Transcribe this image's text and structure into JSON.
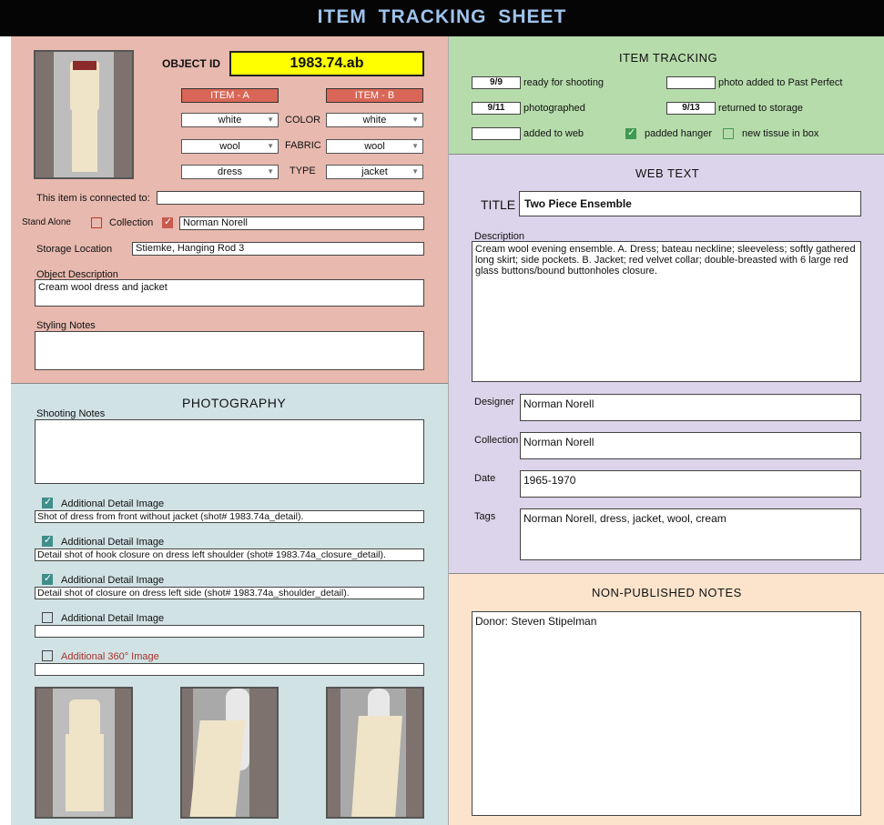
{
  "header": {
    "title": "ITEM TRACKING SHEET"
  },
  "object": {
    "id_label": "OBJECT ID",
    "id_value": "1983.74.ab",
    "item_a": "ITEM - A",
    "item_b": "ITEM - B",
    "color_label": "COLOR",
    "fabric_label": "FABRIC",
    "type_label": "TYPE",
    "a_color": "white",
    "b_color": "white",
    "a_fabric": "wool",
    "b_fabric": "wool",
    "a_type": "dress",
    "b_type": "jacket",
    "connected_label": "This item is connected to:",
    "connected_value": "",
    "standalone_label": "Stand Alone",
    "collection_label": "Collection",
    "collection_value": "Norman Norell",
    "storage_label": "Storage Location",
    "storage_value": "Stiemke, Hanging Rod 3",
    "desc_label": "Object Description",
    "desc_value": "Cream wool dress and jacket",
    "styling_label": "Styling Notes",
    "styling_value": ""
  },
  "photography": {
    "title": "PHOTOGRAPHY",
    "shooting_label": "Shooting Notes",
    "shooting_value": "",
    "details": [
      {
        "label": "Additional Detail Image",
        "checked": true,
        "value": "Shot of dress from front without jacket (shot# 1983.74a_detail)."
      },
      {
        "label": "Additional Detail Image",
        "checked": true,
        "value": "Detail shot of hook closure on dress left shoulder (shot# 1983.74a_closure_detail)."
      },
      {
        "label": "Additional Detail Image",
        "checked": true,
        "value": "Detail shot of closure on dress left side (shot# 1983.74a_shoulder_detail)."
      },
      {
        "label": "Additional Detail Image",
        "checked": false,
        "value": ""
      }
    ],
    "image360_label": "Additional 360° Image",
    "image360_value": ""
  },
  "tracking": {
    "title": "ITEM  TRACKING",
    "ready_date": "9/9",
    "ready_label": "ready for shooting",
    "pp_date": "",
    "pp_label": "photo added to Past Perfect",
    "photographed_date": "9/11",
    "photographed_label": "photographed",
    "returned_date": "9/13",
    "returned_label": "returned to storage",
    "web_date": "",
    "web_label": "added to web",
    "padded_label": "padded hanger",
    "tissue_label": "new tissue in box"
  },
  "web": {
    "title": "WEB TEXT",
    "title_label": "TITLE",
    "title_value": "Two Piece Ensemble",
    "desc_label": "Description",
    "desc_value": "Cream wool evening ensemble. A. Dress; bateau neckline; sleeveless; softly gathered long skirt; side pockets. B. Jacket; red velvet collar; double-breasted with 6 large red glass buttons/bound buttonholes closure.",
    "designer_label": "Designer",
    "designer_value": "Norman Norell",
    "collection_label": "Collection",
    "collection_value": "Norman Norell",
    "date_label": "Date",
    "date_value": "1965-1970",
    "tags_label": "Tags",
    "tags_value": "Norman Norell, dress, jacket, wool, cream"
  },
  "notes": {
    "title": "NON-PUBLISHED NOTES",
    "value": "Donor: Steven Stipelman"
  },
  "icons": {
    "dropdown": "chevron-down-icon",
    "check": "checkmark-icon"
  },
  "colors": {
    "pink": "#e8b9ae",
    "blue": "#d1e2e4",
    "green": "#b6dcab",
    "lavender": "#dcd4ea",
    "peach": "#fbe4cb",
    "yellow": "#ffff00",
    "item_header": "#d96656"
  }
}
